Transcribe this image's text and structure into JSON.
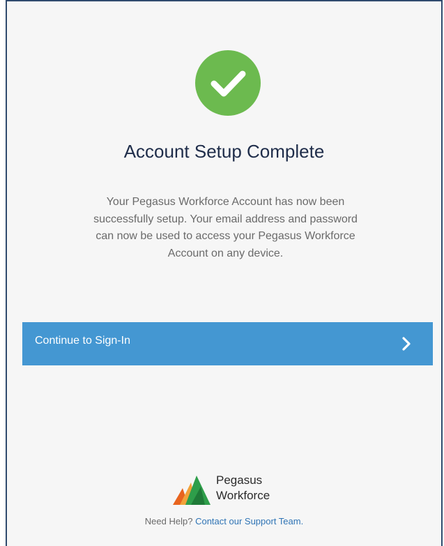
{
  "header": {
    "title": "Account Setup Complete"
  },
  "message": {
    "line1": "Your Pegasus Workforce Account has now been",
    "line2": "successfully setup. Your email address and password",
    "line3": "can now be used to access your Pegasus Workforce",
    "line4": "Account on any device."
  },
  "continue_button": {
    "label": "Continue to Sign-In",
    "icon": "chevron-right-icon"
  },
  "logo": {
    "line1": "Pegasus",
    "line2": "Workforce"
  },
  "help": {
    "prefix": "Need Help?",
    "link_text": "Contact our Support Team."
  },
  "colors": {
    "success": "#6cba4f",
    "button": "#4497d2",
    "title": "#1f2d4a",
    "link": "#2f74b5",
    "logo_green": "#2e9e4a",
    "logo_orange": "#e8641f"
  },
  "icons": {
    "status": "checkmark-icon"
  }
}
